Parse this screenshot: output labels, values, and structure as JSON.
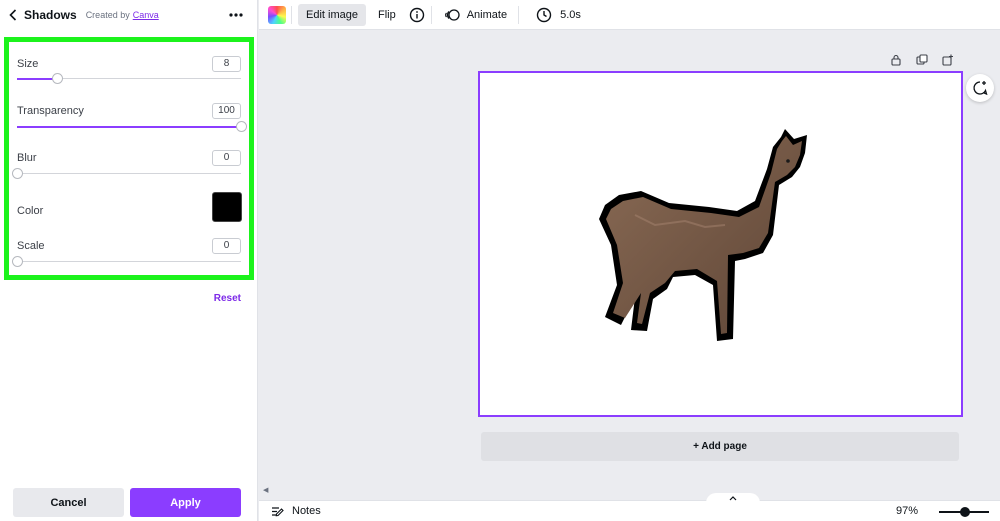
{
  "panel": {
    "back_icon": "chevron-left-icon",
    "title": "Shadows",
    "created_by_prefix": "Created by",
    "created_by_link": "Canva",
    "more_icon": "more-horizontal-icon",
    "controls": {
      "size": {
        "label": "Size",
        "value": "8",
        "fraction": 0.18
      },
      "transparency": {
        "label": "Transparency",
        "value": "100",
        "fraction": 1.0
      },
      "blur": {
        "label": "Blur",
        "value": "0",
        "fraction": 0.0
      },
      "color": {
        "label": "Color",
        "swatch": "#000000"
      },
      "scale": {
        "label": "Scale",
        "value": "0",
        "fraction": 0.0
      }
    },
    "reset_label": "Reset",
    "cancel_label": "Cancel",
    "apply_label": "Apply",
    "highlight_color": "#1cf31c",
    "accent": "#8b3dff"
  },
  "toolbar": {
    "color_icon": "rainbow-color-icon",
    "edit_image_label": "Edit image",
    "flip_label": "Flip",
    "info_icon": "info-icon",
    "animate_icon": "animate-icon",
    "animate_label": "Animate",
    "clock_icon": "clock-icon",
    "duration_label": "5.0s"
  },
  "canvas": {
    "page_actions": [
      "lock-icon",
      "duplicate-icon",
      "add-page-icon"
    ],
    "comment_icon": "add-comment-icon",
    "image_subject": "alpaca photo with black shadow outline",
    "add_page_label": "+ Add page"
  },
  "footer": {
    "notes_icon": "notes-icon",
    "notes_label": "Notes",
    "expand_icon": "chevron-up-icon",
    "zoom_label": "97%",
    "zoom_fraction": 0.52
  }
}
